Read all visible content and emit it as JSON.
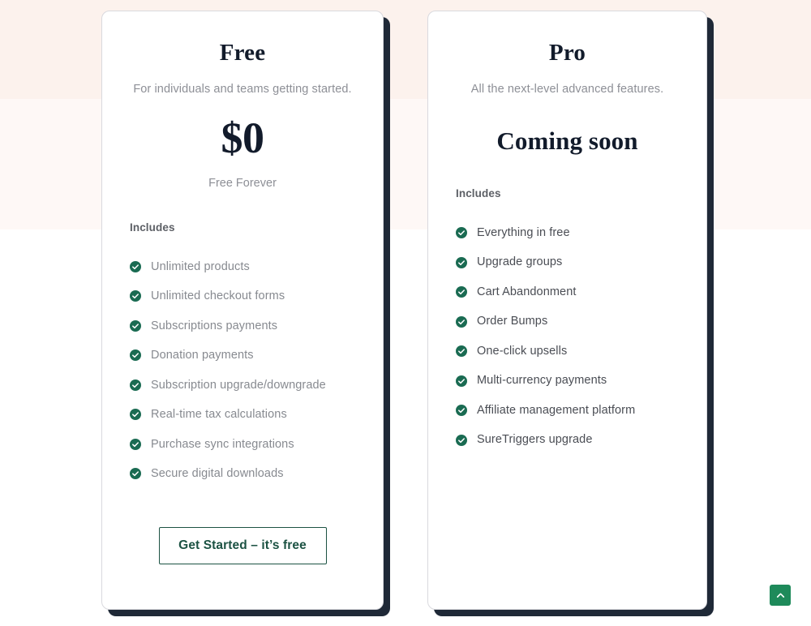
{
  "theme": {
    "band_top_color": "#fcf2ed",
    "band_mid_color": "#fef8f6",
    "page_background": "#ffffff",
    "card_shadow_color": "#1f2937",
    "check_icon_color": "#1a6b52",
    "accent_green": "#1c5243",
    "scroll_button_color": "#1e8a5a",
    "heading_color": "#121b2b",
    "muted_text_color": "#8d8f96"
  },
  "plans": [
    {
      "id": "free",
      "name": "Free",
      "subtitle": "For individuals and teams getting started.",
      "price": "$0",
      "price_note": "Free Forever",
      "includes_label": "Includes",
      "features": [
        "Unlimited products",
        "Unlimited checkout forms",
        "Subscriptions payments",
        "Donation payments",
        "Subscription upgrade/downgrade",
        "Real-time tax calculations",
        "Purchase sync integrations",
        "Secure digital downloads"
      ],
      "cta_label": "Get Started – it’s free"
    },
    {
      "id": "pro",
      "name": "Pro",
      "subtitle": "All the next-level advanced features.",
      "price": "Coming soon",
      "includes_label": "Includes",
      "features": [
        "Everything in free",
        "Upgrade groups",
        "Cart Abandonment",
        "Order Bumps",
        "One-click upsells",
        "Multi-currency payments",
        "Affiliate management platform",
        "SureTriggers upgrade"
      ]
    }
  ],
  "scroll_to_top": {
    "icon": "chevron-up-icon",
    "label": "Scroll to top"
  }
}
